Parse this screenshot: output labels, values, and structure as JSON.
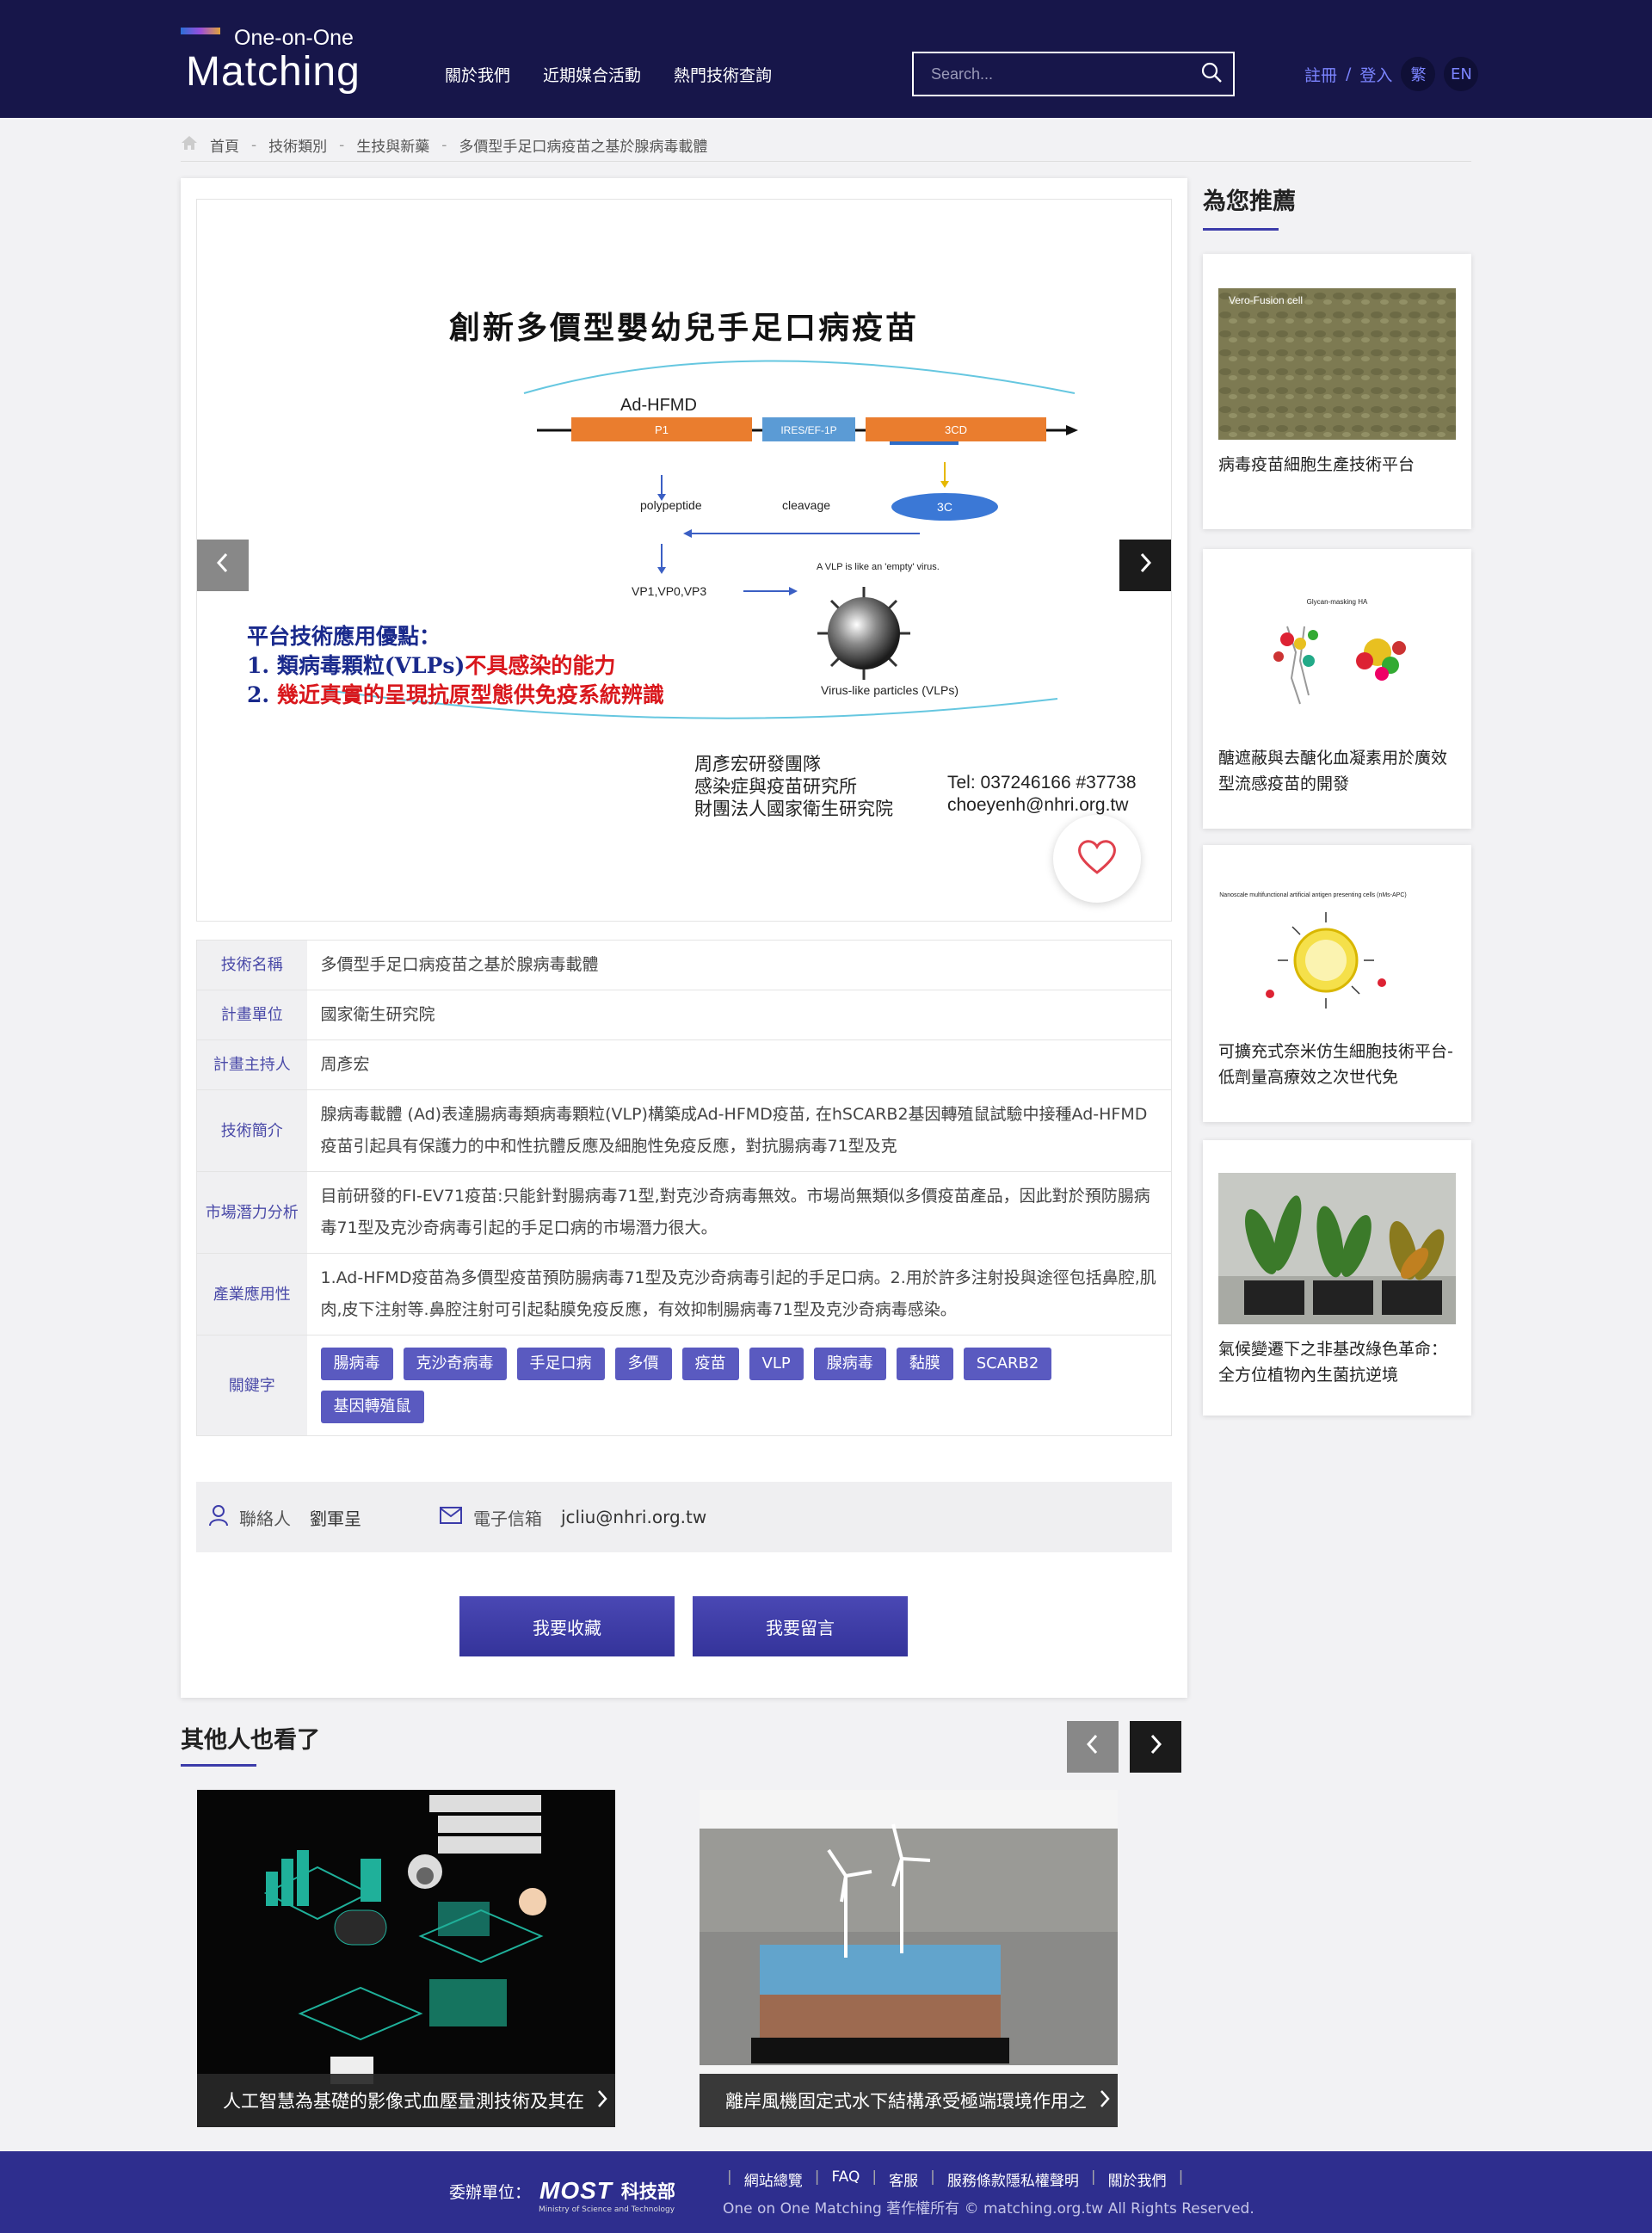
{
  "header": {
    "logo_top": "One-on-One",
    "logo_main": "Matching",
    "nav": [
      "關於我們",
      "近期媒合活動",
      "熱門技術查詢"
    ],
    "search_placeholder": "Search...",
    "register": "註冊",
    "divider": "/",
    "login": "登入",
    "lang_tw": "繁",
    "lang_en": "EN"
  },
  "breadcrumb": [
    "首頁",
    "技術類別",
    "生技與新藥",
    "多價型手足口病疫苗之基於腺病毒載體"
  ],
  "breadcrumb_sep": "-",
  "slide": {
    "title": "創新多價型嬰幼兒手足口病疫苗",
    "construct": "Ad-HFMD",
    "segment_p1": "P1",
    "segment_ires": "IRES/EF-1P",
    "segment_3cd": "3CD",
    "label_polypeptide": "polypeptide",
    "label_cleavage": "cleavage",
    "label_3c": "3C",
    "label_vp": "VP1,VP0,VP3",
    "label_vlp_note": "A VLP is like an 'empty' virus.",
    "label_vlp": "Virus-like particles (VLPs)",
    "benefit_title": "平台技術應用優點：",
    "benefit_1_num": "1.",
    "benefit_1_blue": "類病毒顆粒(VLPs)",
    "benefit_1_red": "不具感染的能力",
    "benefit_2_num": "2.",
    "benefit_2_red": "幾近真實的呈現抗原型態供免疫系統辨識",
    "team_1": "周彥宏研發團隊",
    "team_2": "感染症與疫苗研究所",
    "team_3": "財團法人國家衛生研究院",
    "tel": "Tel: 037246166 #37738",
    "email": "choeyenh@nhri.org.tw"
  },
  "info": {
    "rows": [
      {
        "label": "技術名稱",
        "value": "多價型手足口病疫苗之基於腺病毒載體"
      },
      {
        "label": "計畫單位",
        "value": "國家衛生研究院"
      },
      {
        "label": "計畫主持人",
        "value": "周彥宏"
      },
      {
        "label": "技術簡介",
        "value": "腺病毒載體 (Ad)表達腸病毒類病毒顆粒(VLP)構築成Ad-HFMD疫苗, 在hSCARB2基因轉殖鼠試驗中接種Ad-HFMD疫苗引起具有保護力的中和性抗體反應及細胞性免疫反應，對抗腸病毒71型及克"
      },
      {
        "label": "市場潛力分析",
        "value": "目前研發的FI-EV71疫苗:只能針對腸病毒71型,對克沙奇病毒無效。市場尚無類似多價疫苗產品，因此對於預防腸病毒71型及克沙奇病毒引起的手足口病的市場潛力很大。"
      },
      {
        "label": "產業應用性",
        "value": "1.Ad-HFMD疫苗為多價型疫苗預防腸病毒71型及克沙奇病毒引起的手足口病。2.用於許多注射投與途徑包括鼻腔,肌肉,皮下注射等.鼻腔注射可引起黏膜免疫反應，有效抑制腸病毒71型及克沙奇病毒感染。"
      }
    ],
    "keywords_label": "關鍵字",
    "keywords": [
      "腸病毒",
      "克沙奇病毒",
      "手足口病",
      "多價",
      "疫苗",
      "VLP",
      "腺病毒",
      "黏膜",
      "SCARB2",
      "基因轉殖鼠"
    ]
  },
  "contact": {
    "person_label": "聯絡人",
    "person": "劉軍呈",
    "email_label": "電子信箱",
    "email": "jcliu@nhri.org.tw"
  },
  "actions": {
    "collect": "我要收藏",
    "message": "我要留言"
  },
  "sidebar": {
    "title": "為您推薦",
    "items": [
      {
        "title": "病毒疫苗細胞生產技術平台",
        "img_text": "Vero-Fusion cell"
      },
      {
        "title": "醣遮蔽與去醣化血凝素用於廣效型流感疫苗的開發",
        "img_text": "Glycan-masking HA"
      },
      {
        "title": "可擴充式奈米仿生細胞技術平台-低劑量高療效之次世代免",
        "img_text": "Nanoscale multifunctional artificial antigen presenting cells (nMs-APC)"
      },
      {
        "title": "氣候變遷下之非基改綠色革命：全方位植物內生菌抗逆境",
        "img_text": ""
      }
    ]
  },
  "others": {
    "title": "其他人也看了",
    "items": [
      {
        "title": "人工智慧為基礎的影像式血壓量測技術及其在"
      },
      {
        "title": "離岸風機固定式水下結構承受極端環境作用之"
      }
    ]
  },
  "footer": {
    "org_label": "委辦單位：",
    "most": "MOST",
    "most_cn": "科技部",
    "most_en": "Ministry of Science and Technology",
    "links": [
      "網站總覽",
      "FAQ",
      "客服",
      "服務條款隱私權聲明",
      "關於我們"
    ],
    "copyright": "One on One Matching 著作權所有 © matching.org.tw All Rights Reserved."
  },
  "colors": {
    "header_bg": "#17164a",
    "accent": "#3c3caa",
    "tag_bg": "#5a5ac0",
    "footer_bg": "#2e2e8e",
    "heart": "#e0414d"
  },
  "icons": [
    "search-icon",
    "home-icon",
    "chevron-left-icon",
    "chevron-right-icon",
    "heart-icon",
    "user-icon",
    "mail-icon"
  ]
}
